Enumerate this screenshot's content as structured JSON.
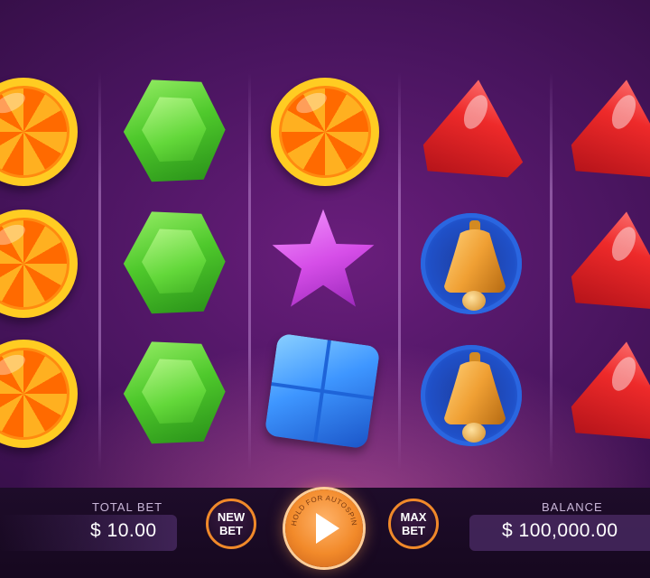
{
  "reels": [
    [
      "orange-candy-icon",
      "orange-candy-icon",
      "orange-candy-icon"
    ],
    [
      "green-hexagon-gem-icon",
      "green-hexagon-gem-icon",
      "green-hexagon-gem-icon"
    ],
    [
      "orange-candy-icon",
      "purple-star-gem-icon",
      "blue-square-gem-icon"
    ],
    [
      "red-triangle-gem-icon",
      "golden-bell-icon",
      "golden-bell-icon"
    ],
    [
      "red-triangle-gem-icon",
      "red-triangle-gem-icon",
      "red-triangle-gem-icon"
    ]
  ],
  "controls": {
    "total_bet_label": "TOTAL BET",
    "total_bet_value": "$ 10.00",
    "new_bet_line1": "NEW",
    "new_bet_line2": "BET",
    "spin_ring_text": "HOLD FOR AUTOSPIN",
    "max_bet_line1": "MAX",
    "max_bet_line2": "BET",
    "balance_label": "BALANCE",
    "balance_value": "$ 100,000.00"
  },
  "colors": {
    "accent": "#f28a2a",
    "background": "#4a1560"
  }
}
